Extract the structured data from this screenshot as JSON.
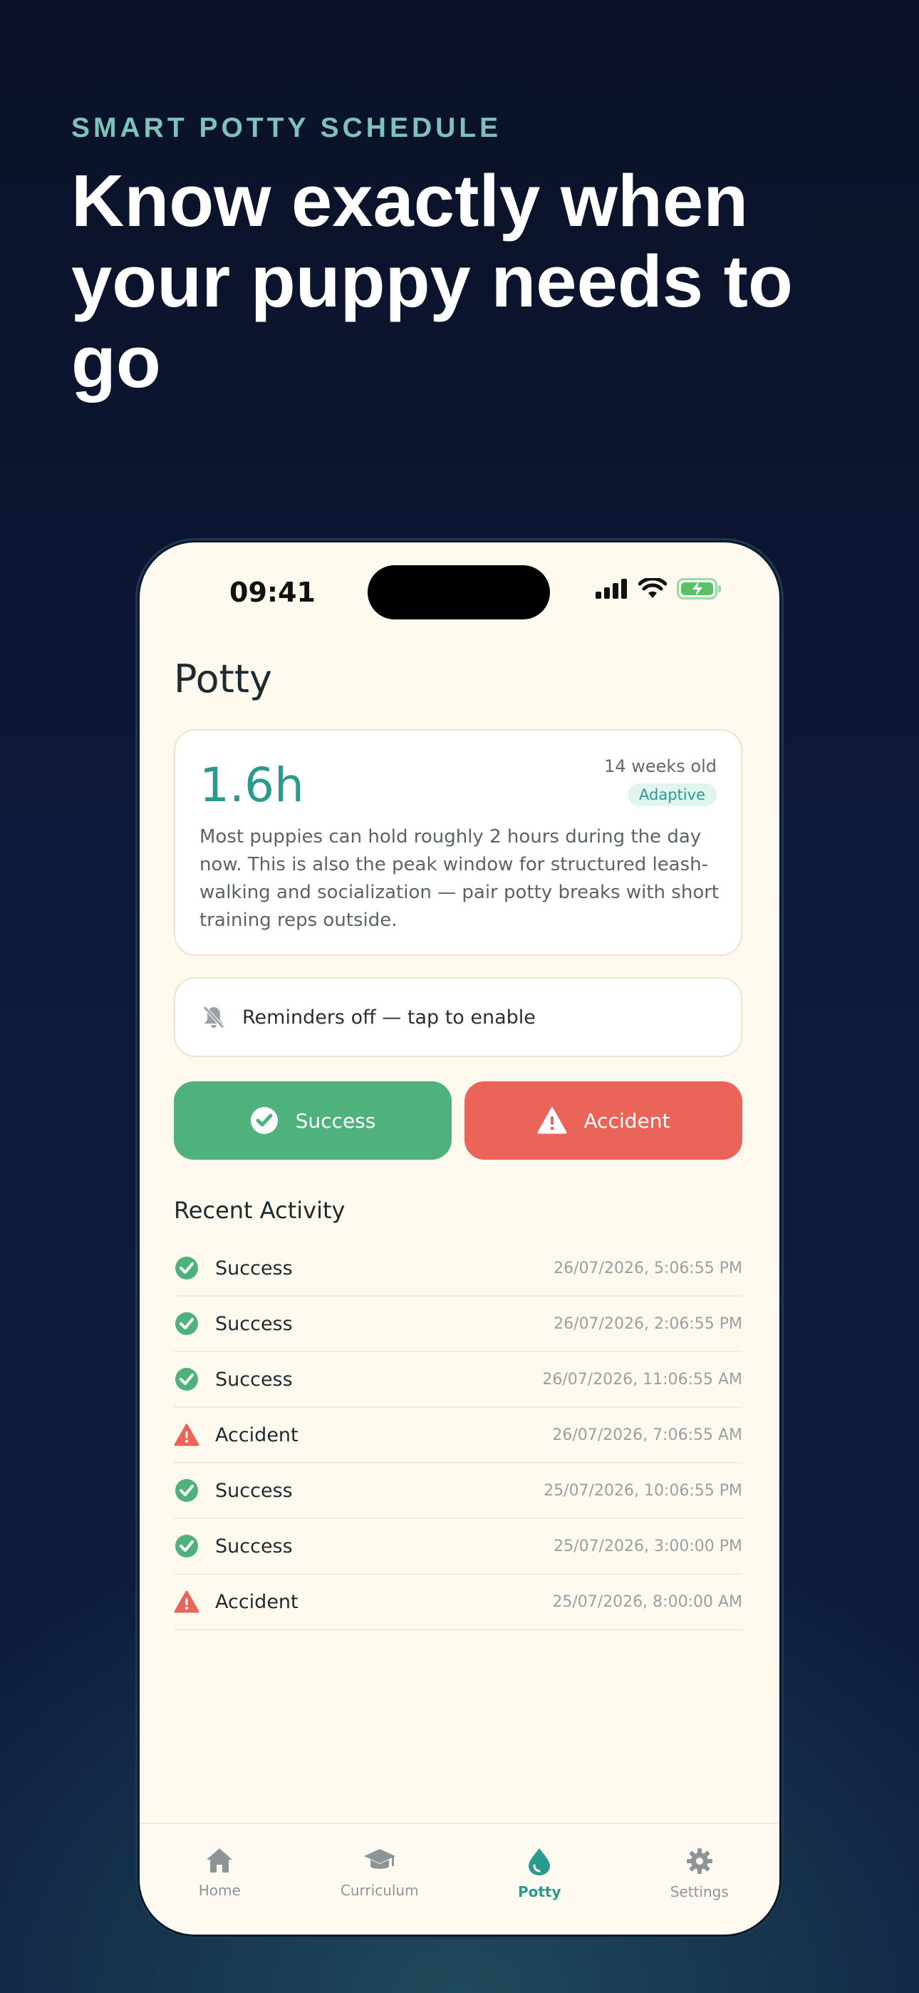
{
  "hero": {
    "eyebrow": "SMART POTTY SCHEDULE",
    "headline": "Know exactly when your puppy needs to go"
  },
  "status_bar": {
    "time": "09:41"
  },
  "screen": {
    "title": "Potty",
    "summary": {
      "hours": "1.6h",
      "age": "14 weeks old",
      "badge": "Adaptive",
      "description": "Most puppies can hold roughly 2 hours during the day now. This is also the peak window for structured leash-walking and socialization — pair potty breaks with short training reps outside."
    },
    "reminder": {
      "label": "Reminders off — tap to enable",
      "icon": "bell-off-icon"
    },
    "buttons": {
      "success_label": "Success",
      "accident_label": "Accident"
    },
    "recent_title": "Recent Activity",
    "activity": [
      {
        "type": "success",
        "label": "Success",
        "time": "26/07/2026, 5:06:55 PM"
      },
      {
        "type": "success",
        "label": "Success",
        "time": "26/07/2026, 2:06:55 PM"
      },
      {
        "type": "success",
        "label": "Success",
        "time": "26/07/2026, 11:06:55 AM"
      },
      {
        "type": "accident",
        "label": "Accident",
        "time": "26/07/2026, 7:06:55 AM"
      },
      {
        "type": "success",
        "label": "Success",
        "time": "25/07/2026, 10:06:55 PM"
      },
      {
        "type": "success",
        "label": "Success",
        "time": "25/07/2026, 3:00:00 PM"
      },
      {
        "type": "accident",
        "label": "Accident",
        "time": "25/07/2026, 8:00:00 AM"
      }
    ]
  },
  "tabs": [
    {
      "label": "Home",
      "icon": "home-icon",
      "active": false
    },
    {
      "label": "Curriculum",
      "icon": "graduation-cap-icon",
      "active": false
    },
    {
      "label": "Potty",
      "icon": "droplet-icon",
      "active": true
    },
    {
      "label": "Settings",
      "icon": "gear-icon",
      "active": false
    }
  ],
  "colors": {
    "accent": "#2a9a8e",
    "success": "#4fb27d",
    "accident": "#ea645a",
    "background": "#fef9ef"
  }
}
